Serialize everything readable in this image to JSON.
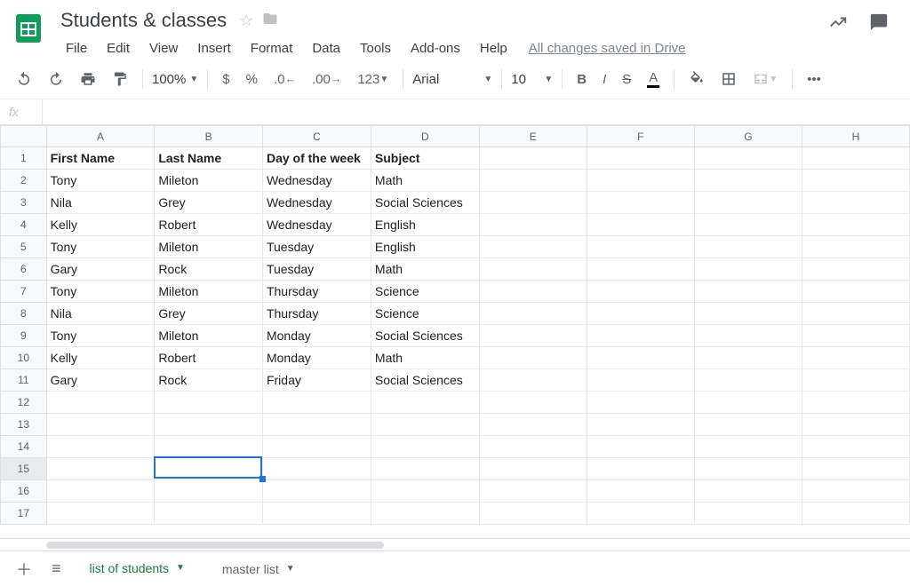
{
  "doc": {
    "title": "Students & classes",
    "save_status": "All changes saved in Drive"
  },
  "menu": {
    "file": "File",
    "edit": "Edit",
    "view": "View",
    "insert": "Insert",
    "format": "Format",
    "data": "Data",
    "tools": "Tools",
    "addons": "Add-ons",
    "help": "Help"
  },
  "toolbar": {
    "zoom": "100%",
    "currency": "$",
    "percent": "%",
    "dec_less": ".0",
    "dec_more": ".00",
    "numfmt": "123",
    "font": "Arial",
    "font_size": "10"
  },
  "columns": [
    "A",
    "B",
    "C",
    "D",
    "E",
    "F",
    "G",
    "H"
  ],
  "header_row": [
    "First Name",
    "Last Name",
    "Day of the week",
    "Subject"
  ],
  "rows": [
    [
      "Tony",
      "Mileton",
      "Wednesday",
      "Math"
    ],
    [
      "Nila",
      "Grey",
      "Wednesday",
      "Social Sciences"
    ],
    [
      "Kelly",
      "Robert",
      "Wednesday",
      "English"
    ],
    [
      "Tony",
      "Mileton",
      "Tuesday",
      "English"
    ],
    [
      "Gary",
      "Rock",
      "Tuesday",
      "Math"
    ],
    [
      "Tony",
      "Mileton",
      "Thursday",
      "Science"
    ],
    [
      "Nila",
      "Grey",
      "Thursday",
      "Science"
    ],
    [
      "Tony",
      "Mileton",
      "Monday",
      "Social Sciences"
    ],
    [
      "Kelly",
      "Robert",
      "Monday",
      "Math"
    ],
    [
      "Gary",
      "Rock",
      "Friday",
      "Social Sciences"
    ]
  ],
  "empty_rows_after": 6,
  "selected_cell": {
    "row": 15,
    "col": "B"
  },
  "tabs": {
    "active": "list of students",
    "other": "master list"
  },
  "fx": ""
}
